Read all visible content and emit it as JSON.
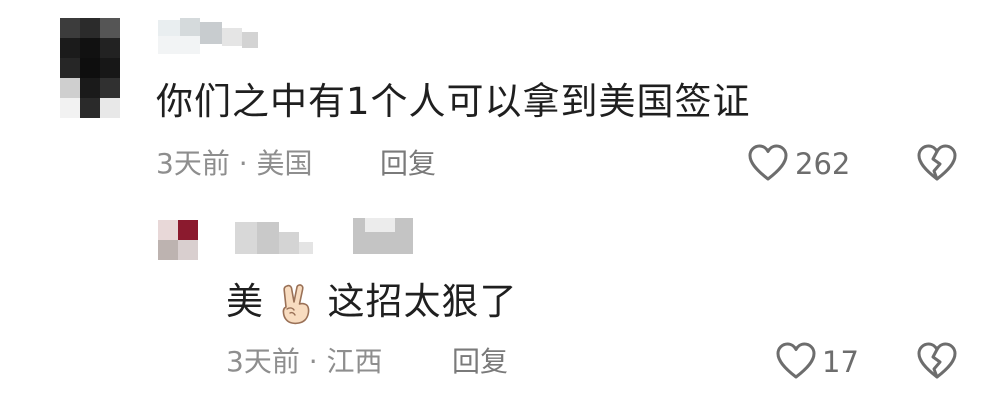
{
  "comments": [
    {
      "text": "你们之中有1个人可以拿到美国签证",
      "time": "3天前",
      "location": "美国",
      "reply_label": "回复",
      "like_count": "262"
    },
    {
      "text_before": "美",
      "emoji": "victory-hand",
      "text_after": "这招太狠了",
      "time": "3天前",
      "location": "江西",
      "reply_label": "回复",
      "like_count": "17"
    }
  ],
  "separator": "·",
  "colors": {
    "text": "#1f1f1f",
    "meta": "#8e8e8e",
    "icon": "#6d6d6d",
    "background": "#ffffff"
  },
  "icons": {
    "like": "heart-outline-icon",
    "dislike": "broken-heart-icon"
  }
}
